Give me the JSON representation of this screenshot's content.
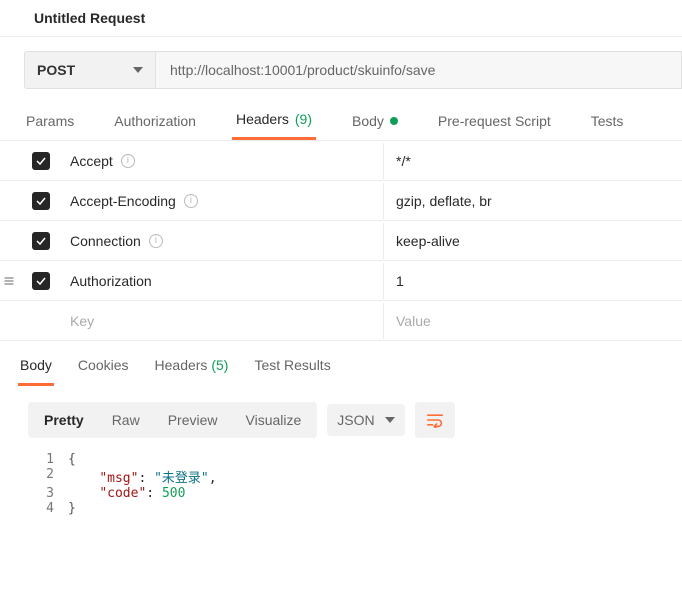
{
  "title": "Untitled Request",
  "request": {
    "method": "POST",
    "url": "http://localhost:10001/product/skuinfo/save"
  },
  "tabs": {
    "params": "Params",
    "auth": "Authorization",
    "headers_label": "Headers",
    "headers_count": "(9)",
    "body": "Body",
    "prereq": "Pre-request Script",
    "tests": "Tests"
  },
  "headers": [
    {
      "checked": true,
      "key": "Accept",
      "info": true,
      "value": "*/*"
    },
    {
      "checked": true,
      "key": "Accept-Encoding",
      "info": true,
      "value": "gzip, deflate, br"
    },
    {
      "checked": true,
      "key": "Connection",
      "info": true,
      "value": "keep-alive"
    },
    {
      "checked": true,
      "drag": true,
      "key": "Authorization",
      "info": false,
      "value": "1"
    }
  ],
  "headers_placeholder_key": "Key",
  "headers_placeholder_value": "Value",
  "response_tabs": {
    "body": "Body",
    "cookies": "Cookies",
    "headers_label": "Headers",
    "headers_count": "(5)",
    "tests": "Test Results"
  },
  "viewmodes": {
    "pretty": "Pretty",
    "raw": "Raw",
    "preview": "Preview",
    "visualize": "Visualize"
  },
  "format": "JSON",
  "response_json": {
    "line1": "{",
    "line2_pre": "    ",
    "line2_key": "\"msg\"",
    "line2_colon": ": ",
    "line2_val": "\"未登录\"",
    "line2_comma": ",",
    "line3_pre": "    ",
    "line3_key": "\"code\"",
    "line3_colon": ": ",
    "line3_val": "500",
    "line4": "}"
  },
  "line_numbers": {
    "l1": "1",
    "l2": "2",
    "l3": "3",
    "l4": "4"
  }
}
